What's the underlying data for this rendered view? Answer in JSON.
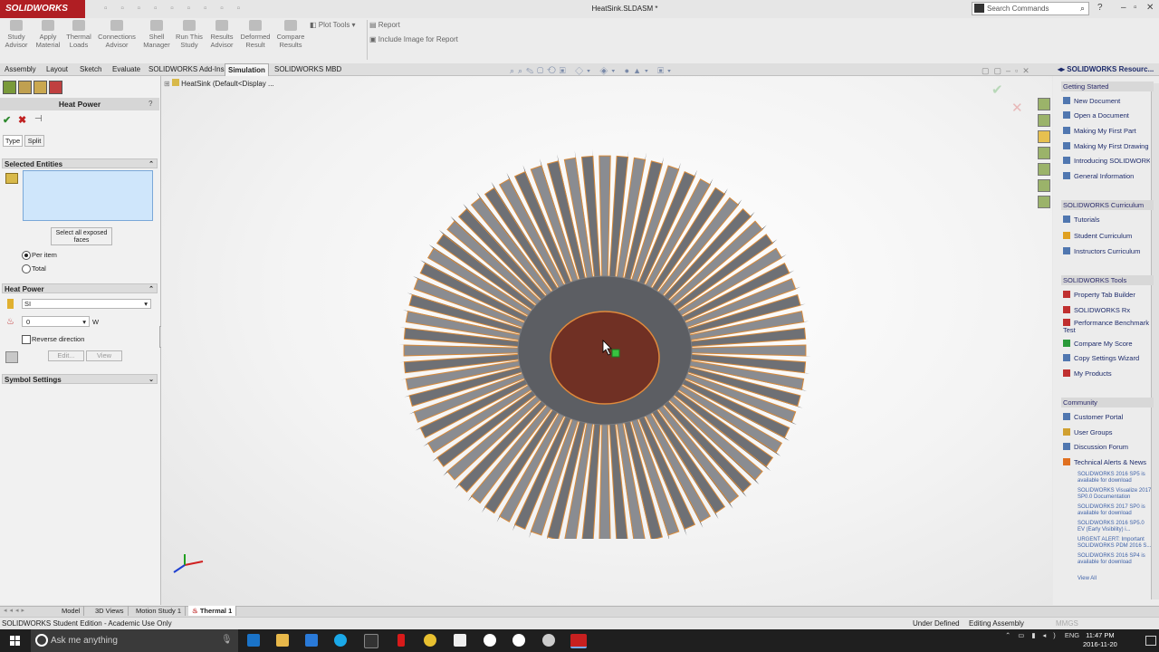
{
  "app": {
    "logo": "SOLIDWORKS",
    "doc_title": "HeatSink.SLDASM *"
  },
  "search": {
    "placeholder": "Search Commands"
  },
  "ribbon": {
    "buttons": [
      {
        "label": "Study Advisor"
      },
      {
        "label": "Apply Material"
      },
      {
        "label": "Thermal Loads"
      },
      {
        "label": "Connections Advisor"
      },
      {
        "label": "Shell Manager"
      },
      {
        "label": "Run This Study"
      },
      {
        "label": "Results Advisor"
      },
      {
        "label": "Deformed Result"
      },
      {
        "label": "Compare Results"
      }
    ],
    "plot_tools": "Plot Tools",
    "report": "Report",
    "include_image": "Include Image for Report"
  },
  "tabs": [
    "Assembly",
    "Layout",
    "Sketch",
    "Evaluate",
    "SOLIDWORKS Add-Ins",
    "Simulation",
    "SOLIDWORKS MBD"
  ],
  "tree": {
    "root": "HeatSink  (Default<Display ..."
  },
  "property_manager": {
    "title": "Heat Power",
    "help": "?",
    "type_tab": "Type",
    "split_tab": "Split",
    "selected_entities": "Selected Entities",
    "select_all_faces": "Select all exposed faces",
    "per_item": "Per item",
    "total": "Total",
    "heat_power_section": "Heat Power",
    "unit_system": "SI",
    "value": "0",
    "unit": "W",
    "reverse_direction": "Reverse direction",
    "edit": "Edit...",
    "view": "View",
    "symbol_settings": "Symbol Settings"
  },
  "task_pane": {
    "header": "SOLIDWORKS Resourc...",
    "getting_started": {
      "title": "Getting Started",
      "items": [
        "New Document",
        "Open a Document",
        "Making My First Part",
        "Making My First Drawing",
        "Introducing SOLIDWORKS",
        "General Information"
      ]
    },
    "curriculum": {
      "title": "SOLIDWORKS Curriculum",
      "items": [
        "Tutorials",
        "Student Curriculum",
        "Instructors Curriculum"
      ]
    },
    "tools": {
      "title": "SOLIDWORKS Tools",
      "items": [
        "Property Tab Builder",
        "SOLIDWORKS Rx",
        "Performance Benchmark Test",
        "Compare My Score",
        "Copy Settings Wizard",
        "My Products"
      ]
    },
    "community": {
      "title": "Community",
      "items": [
        "Customer Portal",
        "User Groups",
        "Discussion Forum",
        "Technical Alerts & News"
      ]
    },
    "news": [
      "SOLIDWORKS 2016 SP5 is available for download",
      "SOLIDWORKS Visualize 2017 SP0.0 Documentation",
      "SOLIDWORKS 2017 SP0 is available for download",
      "SOLIDWORKS 2016 SP5.0 EV (Early Visibility) i...",
      "URGENT ALERT: Important SOLIDWORKS PDM 2016 S...",
      "SOLIDWORKS 2016 SP4 is available for download"
    ],
    "view_all": "View All"
  },
  "bottom_tabs": [
    "Model",
    "3D Views",
    "Motion Study 1",
    "Thermal 1"
  ],
  "status": {
    "edition": "SOLIDWORKS Student Edition - Academic Use Only",
    "state": "Under Defined",
    "mode": "Editing Assembly",
    "units": "MMGS"
  },
  "taskbar": {
    "search": "Ask me anything",
    "lang": "ENG",
    "time": "11:47 PM",
    "date": "2016-11-20"
  }
}
